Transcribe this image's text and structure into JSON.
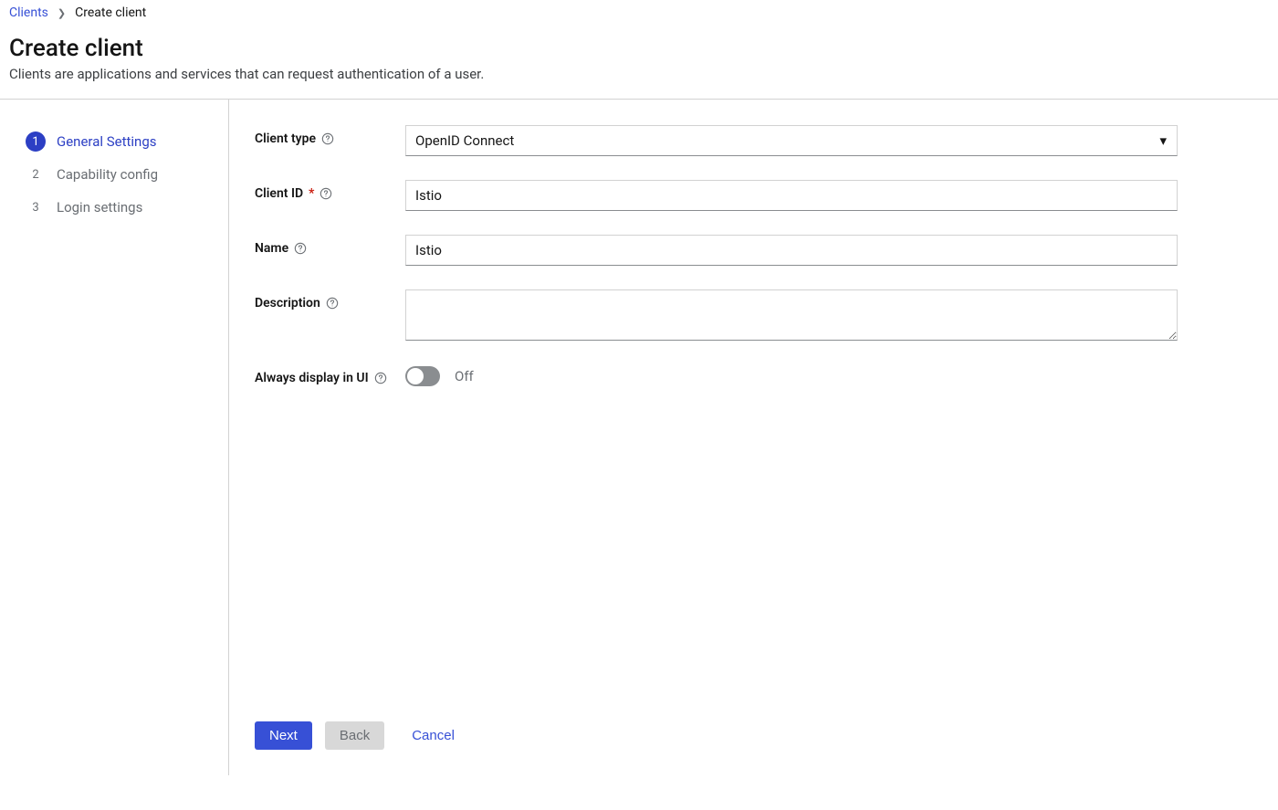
{
  "breadcrumb": {
    "parent": "Clients",
    "current": "Create client"
  },
  "header": {
    "title": "Create client",
    "subtitle": "Clients are applications and services that can request authentication of a user."
  },
  "wizard": {
    "steps": [
      {
        "num": "1",
        "label": "General Settings",
        "active": true
      },
      {
        "num": "2",
        "label": "Capability config",
        "active": false
      },
      {
        "num": "3",
        "label": "Login settings",
        "active": false
      }
    ]
  },
  "form": {
    "client_type": {
      "label": "Client type",
      "value": "OpenID Connect"
    },
    "client_id": {
      "label": "Client ID",
      "required": true,
      "value": "Istio"
    },
    "name": {
      "label": "Name",
      "value": "Istio"
    },
    "description": {
      "label": "Description",
      "value": ""
    },
    "always_display": {
      "label": "Always display in UI",
      "state_label": "Off"
    }
  },
  "actions": {
    "next": "Next",
    "back": "Back",
    "cancel": "Cancel"
  }
}
